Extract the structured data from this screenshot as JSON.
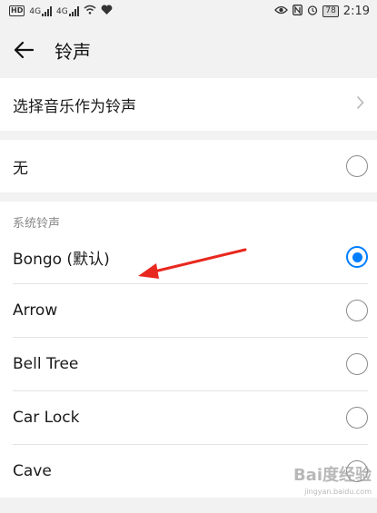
{
  "status_bar": {
    "hd": "HD",
    "network1": "4G",
    "network2": "4G",
    "battery": "78",
    "time": "2:19"
  },
  "header": {
    "title": "铃声"
  },
  "music_row": {
    "label": "选择音乐作为铃声"
  },
  "none_row": {
    "label": "无"
  },
  "system_section": {
    "title": "系统铃声",
    "items": [
      {
        "label": "Bongo (默认)",
        "selected": true
      },
      {
        "label": "Arrow",
        "selected": false
      },
      {
        "label": "Bell Tree",
        "selected": false
      },
      {
        "label": "Car Lock",
        "selected": false
      },
      {
        "label": "Cave",
        "selected": false
      }
    ]
  },
  "colors": {
    "accent": "#007dff",
    "annotation": "#e8281e"
  },
  "watermark": {
    "brand": "Bai度经验",
    "url": "jingyan.baidu.com"
  }
}
